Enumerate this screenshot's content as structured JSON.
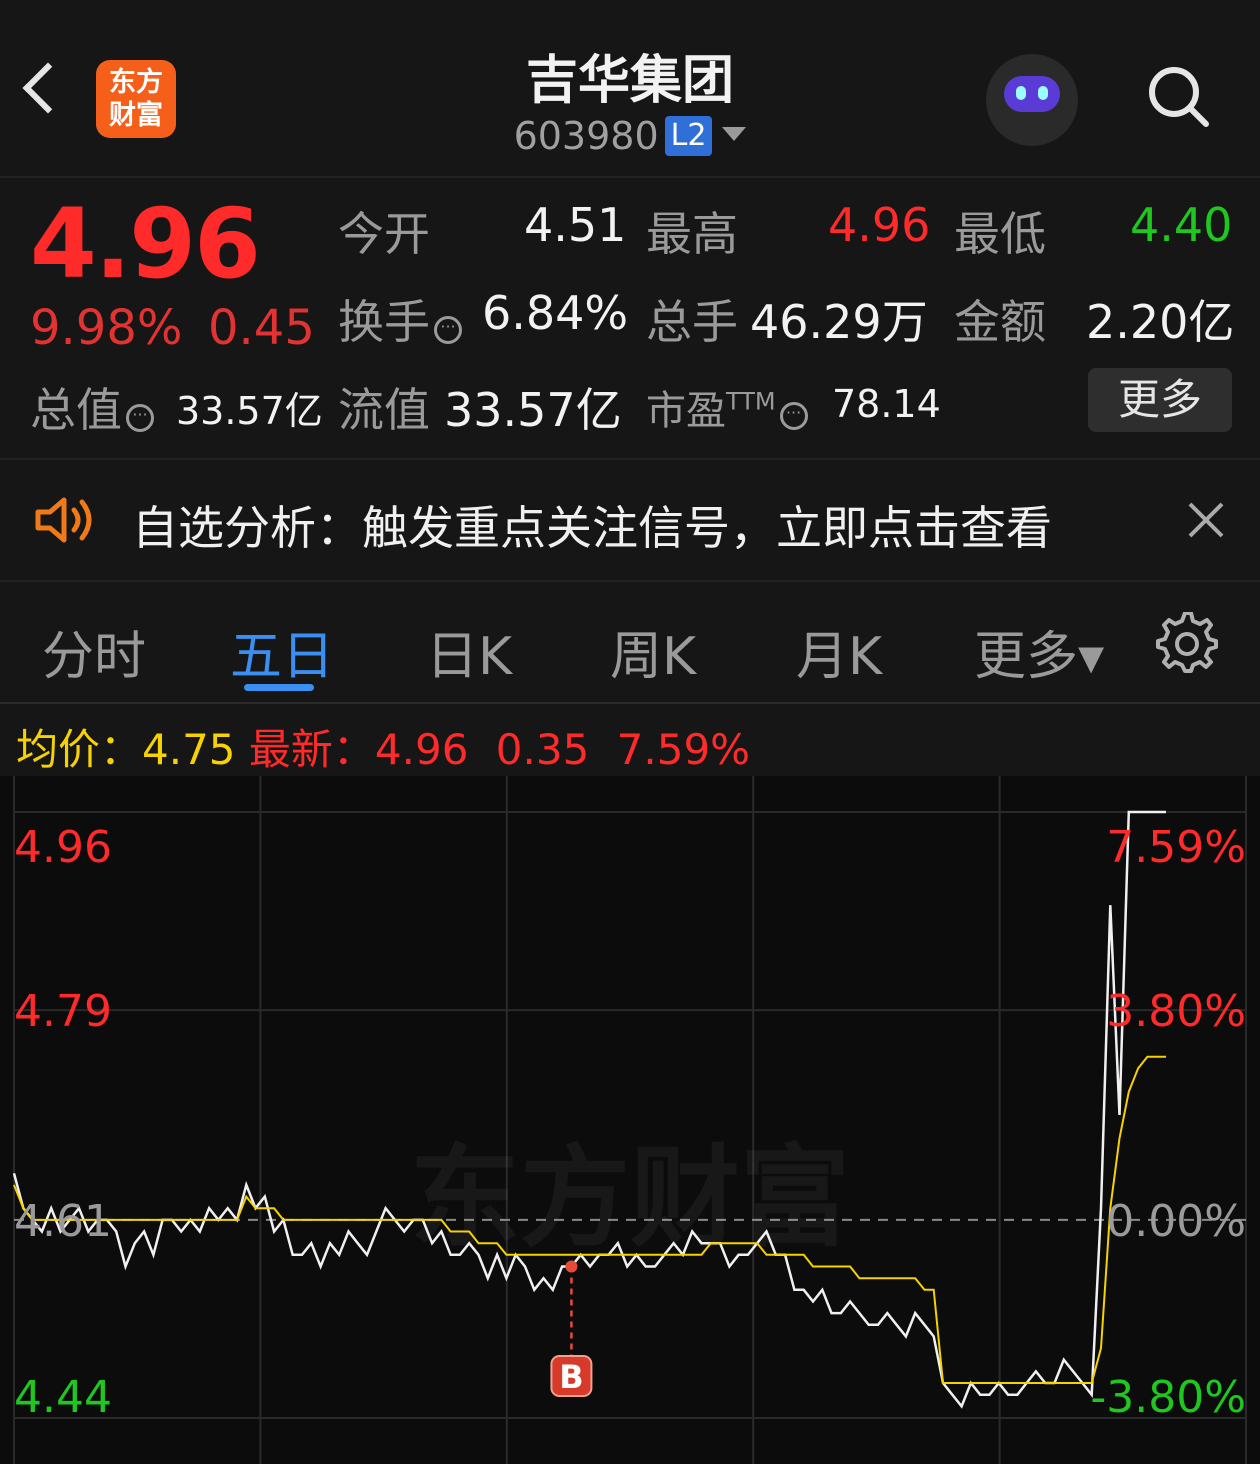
{
  "header": {
    "logo_line1": "东方",
    "logo_line2": "财富",
    "title": "吉华集团",
    "code": "603980",
    "level_badge": "L2",
    "icons": [
      "back-icon",
      "robot-avatar-icon",
      "search-icon"
    ]
  },
  "quote": {
    "price": "4.96",
    "change_pct": "9.98%",
    "change": "0.45",
    "open_label": "今开",
    "open": "4.51",
    "high_label": "最高",
    "high": "4.96",
    "low_label": "最低",
    "low": "4.40",
    "turnover_label": "换手",
    "turnover": "6.84%",
    "volume_label": "总手",
    "volume": "46.29万",
    "amount_label": "金额",
    "amount": "2.20亿",
    "mcap_label": "总值",
    "mcap": "33.57亿",
    "float_label": "流值",
    "float_cap": "33.57亿",
    "pe_label": "市盈",
    "pe_sup": "TTM",
    "pe": "78.14",
    "more_button": "更多",
    "colors": {
      "up": "#ff2a2a",
      "down": "#1ec81e"
    }
  },
  "banner": {
    "text": "自选分析：触发重点关注信号，立即点击查看"
  },
  "tabs": [
    {
      "label": "分时",
      "active": false
    },
    {
      "label": "五日",
      "active": true
    },
    {
      "label": "日K",
      "active": false
    },
    {
      "label": "周K",
      "active": false
    },
    {
      "label": "月K",
      "active": false
    },
    {
      "label": "更多▾",
      "active": false
    }
  ],
  "chart_head": {
    "avg_label": "均价：",
    "avg_value": "4.75",
    "latest_label": "最新：",
    "latest_value": "4.96",
    "latest_change": "0.35",
    "latest_pct": "7.59%"
  },
  "chart_data": {
    "type": "line",
    "y_left_labels": [
      "4.96",
      "4.79",
      "4.61",
      "4.44"
    ],
    "y_right_labels": [
      "7.59%",
      "3.80%",
      "0.00%",
      "-3.80%"
    ],
    "ylim": [
      4.44,
      4.96
    ],
    "base_price": 4.61,
    "days": 5,
    "signal_marker": "B",
    "watermark": "东方财富",
    "series": [
      {
        "name": "price",
        "color": "#f0f0f0",
        "values": [
          4.65,
          4.62,
          4.61,
          4.6,
          4.62,
          4.6,
          4.61,
          4.62,
          4.6,
          4.61,
          4.61,
          4.6,
          4.57,
          4.59,
          4.6,
          4.58,
          4.61,
          4.61,
          4.6,
          4.61,
          4.6,
          4.62,
          4.61,
          4.62,
          4.61,
          4.64,
          4.62,
          4.63,
          4.6,
          4.61,
          4.58,
          4.58,
          4.59,
          4.57,
          4.59,
          4.58,
          4.6,
          4.59,
          4.58,
          4.6,
          4.62,
          4.61,
          4.6,
          4.61,
          4.61,
          4.59,
          4.6,
          4.58,
          4.58,
          4.59,
          4.58,
          4.56,
          4.58,
          4.56,
          4.58,
          4.57,
          4.55,
          4.56,
          4.55,
          4.57,
          4.57,
          4.58,
          4.57,
          4.58,
          4.58,
          4.59,
          4.57,
          4.58,
          4.57,
          4.57,
          4.58,
          4.59,
          4.58,
          4.6,
          4.59,
          4.59,
          4.59,
          4.57,
          4.58,
          4.58,
          4.59,
          4.6,
          4.58,
          4.58,
          4.55,
          4.55,
          4.54,
          4.55,
          4.53,
          4.53,
          4.54,
          4.53,
          4.52,
          4.52,
          4.53,
          4.52,
          4.51,
          4.53,
          4.52,
          4.51,
          4.47,
          4.46,
          4.45,
          4.47,
          4.46,
          4.46,
          4.47,
          4.46,
          4.46,
          4.47,
          4.48,
          4.47,
          4.47,
          4.49,
          4.48,
          4.47,
          4.46,
          4.62,
          4.88,
          4.7,
          4.96,
          4.96,
          4.96,
          4.96,
          4.96
        ]
      },
      {
        "name": "average",
        "color": "#f6d200",
        "values": [
          4.64,
          4.62,
          4.61,
          4.61,
          4.61,
          4.61,
          4.61,
          4.61,
          4.61,
          4.61,
          4.61,
          4.61,
          4.61,
          4.61,
          4.61,
          4.61,
          4.61,
          4.61,
          4.61,
          4.61,
          4.61,
          4.61,
          4.61,
          4.61,
          4.61,
          4.63,
          4.62,
          4.62,
          4.62,
          4.61,
          4.61,
          4.61,
          4.61,
          4.61,
          4.61,
          4.61,
          4.61,
          4.61,
          4.61,
          4.61,
          4.61,
          4.61,
          4.61,
          4.61,
          4.61,
          4.61,
          4.61,
          4.6,
          4.6,
          4.6,
          4.59,
          4.59,
          4.59,
          4.58,
          4.58,
          4.58,
          4.58,
          4.58,
          4.58,
          4.58,
          4.58,
          4.58,
          4.58,
          4.58,
          4.58,
          4.58,
          4.58,
          4.58,
          4.58,
          4.58,
          4.58,
          4.58,
          4.58,
          4.58,
          4.58,
          4.59,
          4.59,
          4.59,
          4.59,
          4.59,
          4.59,
          4.58,
          4.58,
          4.58,
          4.58,
          4.58,
          4.57,
          4.57,
          4.57,
          4.57,
          4.57,
          4.56,
          4.56,
          4.56,
          4.56,
          4.56,
          4.56,
          4.56,
          4.55,
          4.55,
          4.47,
          4.47,
          4.47,
          4.47,
          4.47,
          4.47,
          4.47,
          4.47,
          4.47,
          4.47,
          4.47,
          4.47,
          4.47,
          4.47,
          4.47,
          4.47,
          4.47,
          4.5,
          4.62,
          4.68,
          4.72,
          4.74,
          4.75,
          4.75,
          4.75
        ]
      }
    ]
  }
}
